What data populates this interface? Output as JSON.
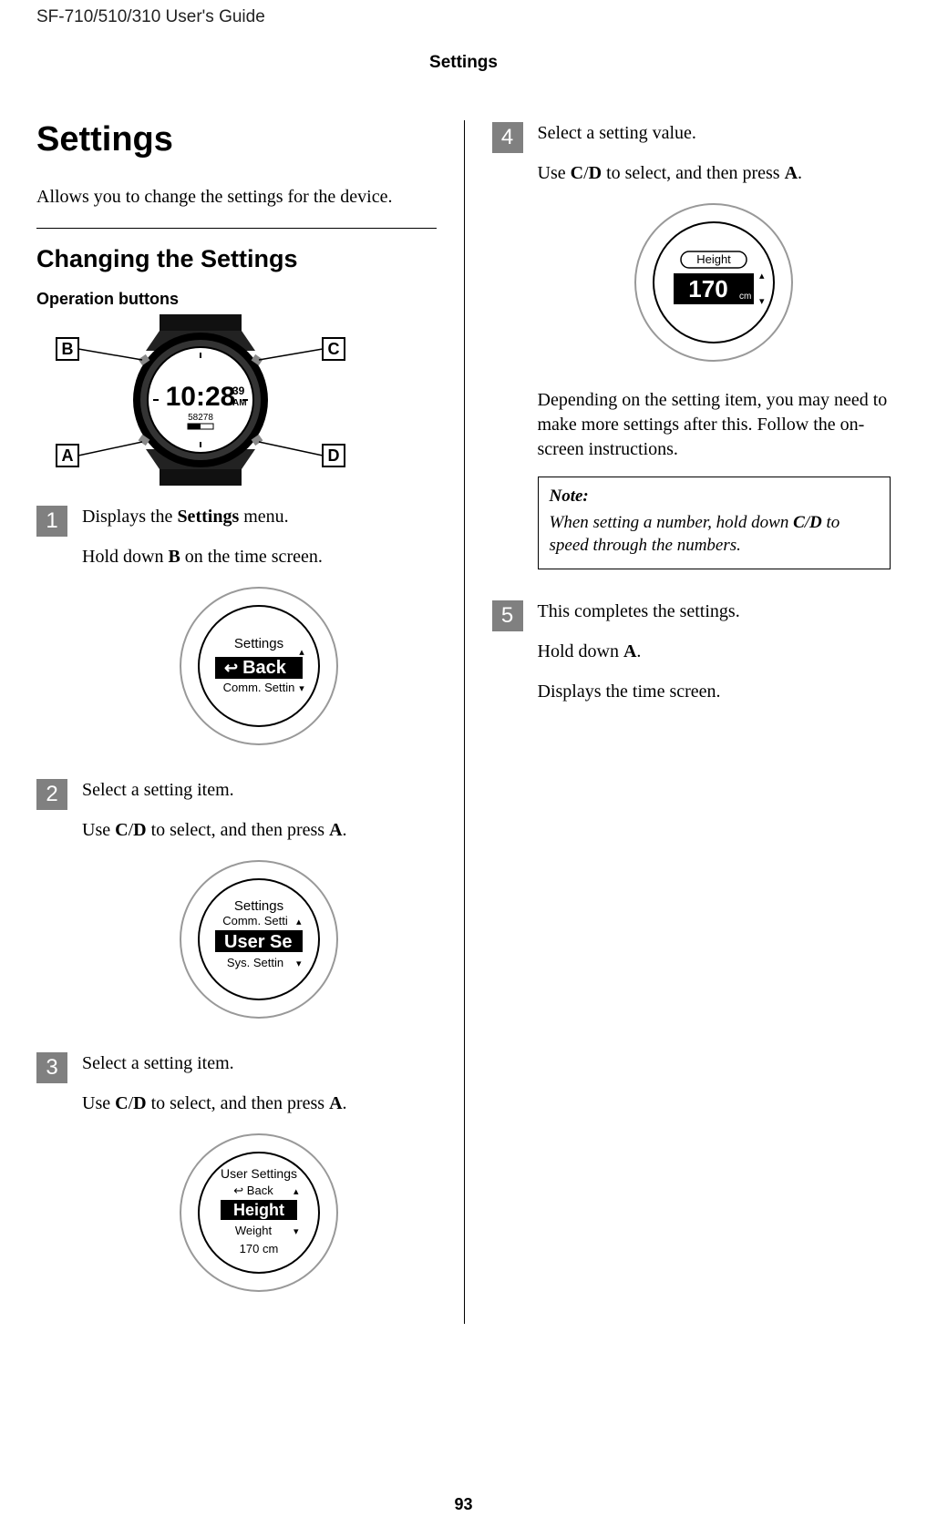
{
  "header": {
    "product_line": "SF-710/510/310     User's Guide",
    "section": "Settings"
  },
  "left": {
    "title": "Settings",
    "intro": "Allows you to change the settings for the device.",
    "subtitle": "Changing the Settings",
    "op_buttons_label": "Operation buttons",
    "watch_time": "10:28",
    "watch_sec": "39",
    "watch_ampm": "AM",
    "watch_sub": "58278",
    "labels": {
      "A": "A",
      "B": "B",
      "C": "C",
      "D": "D"
    },
    "steps": [
      {
        "num": "1",
        "line1_pre": "Displays the ",
        "line1_bold": "Settings",
        "line1_post": " menu.",
        "line2_pre": "Hold down ",
        "line2_bold": "B",
        "line2_post": " on the time screen.",
        "screen": {
          "title": "Settings",
          "row_top": "",
          "row_sel_pre": "↩ ",
          "row_sel": "Back",
          "row_bot": "Comm. Settin",
          "arrow_up": "▴",
          "arrow_dn": "▾"
        }
      },
      {
        "num": "2",
        "line1": "Select a setting item.",
        "line2_pre": "Use ",
        "line2_b1": "C",
        "line2_mid": "/",
        "line2_b2": "D",
        "line2_mid2": " to select, and then press ",
        "line2_b3": "A",
        "line2_post": ".",
        "screen": {
          "title": "Settings",
          "row_top": "Comm. Setti",
          "row_sel": "User Se",
          "row_bot": "Sys. Settin",
          "arrow_up": "▴",
          "arrow_dn": "▾"
        }
      },
      {
        "num": "3",
        "line1": "Select a setting item.",
        "line2_pre": "Use ",
        "line2_b1": "C",
        "line2_mid": "/",
        "line2_b2": "D",
        "line2_mid2": " to select, and then press ",
        "line2_b3": "A",
        "line2_post": ".",
        "screen": {
          "title": "User Settings",
          "row_top_pre": "↩ ",
          "row_top": "Back",
          "row_sel": "Height",
          "row_bot": "Weight",
          "footer": "170 cm",
          "arrow_up": "▴",
          "arrow_dn": "▾"
        }
      }
    ]
  },
  "right": {
    "steps": [
      {
        "num": "4",
        "line1": "Select a setting value.",
        "line2_pre": "Use ",
        "line2_b1": "C",
        "line2_mid": "/",
        "line2_b2": "D",
        "line2_mid2": " to select, and then press ",
        "line2_b3": "A",
        "line2_post": ".",
        "screen": {
          "title": "Height",
          "value": "170",
          "unit": "cm",
          "arrow_up": "▴",
          "arrow_dn": "▾"
        },
        "after_text": "Depending on the setting item, you may need to make more settings after this. Follow the on-screen instructions.",
        "note_title": "Note:",
        "note_text_pre": "When setting a number, hold down ",
        "note_b1": "C",
        "note_mid": "/",
        "note_b2": "D",
        "note_text_post": " to speed through the numbers."
      },
      {
        "num": "5",
        "line1": "This completes the settings.",
        "line2_pre": "Hold down ",
        "line2_bold": "A",
        "line2_post": ".",
        "line3": "Displays the time screen."
      }
    ]
  },
  "page_number": "93"
}
